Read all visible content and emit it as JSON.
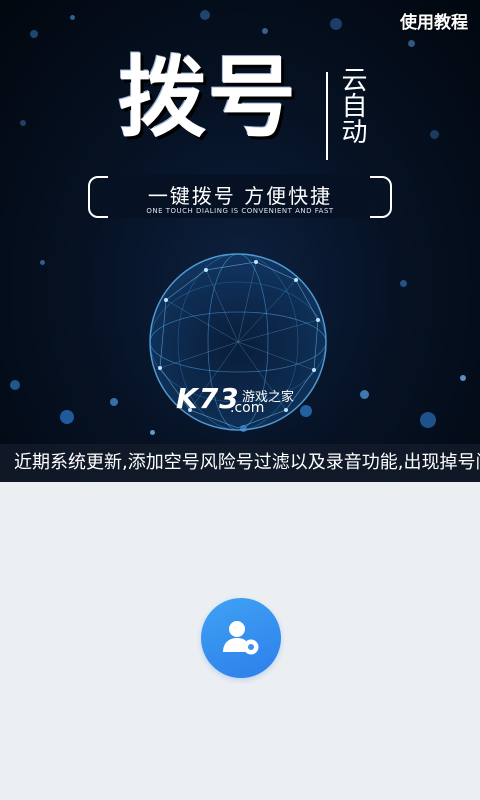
{
  "header": {
    "tutorial_label": "使用教程"
  },
  "banner": {
    "headline": "拨号",
    "side_title": "云自动",
    "slogan": "一键拨号 方便快捷",
    "slogan_en": "ONE TOUCH DIALING IS CONVENIENT AND FAST",
    "watermark": {
      "brand": "K73",
      "domain": ".com",
      "tagline": "游戏之家"
    }
  },
  "notice": {
    "text": "近期系统更新,添加空号风险号过滤以及录音功能,出现掉号问"
  },
  "main": {
    "user_button_icon": "user-settings-icon"
  },
  "colors": {
    "banner_bg": "#061224",
    "page_bg": "#eceff2",
    "accent": "#2d7fea"
  }
}
